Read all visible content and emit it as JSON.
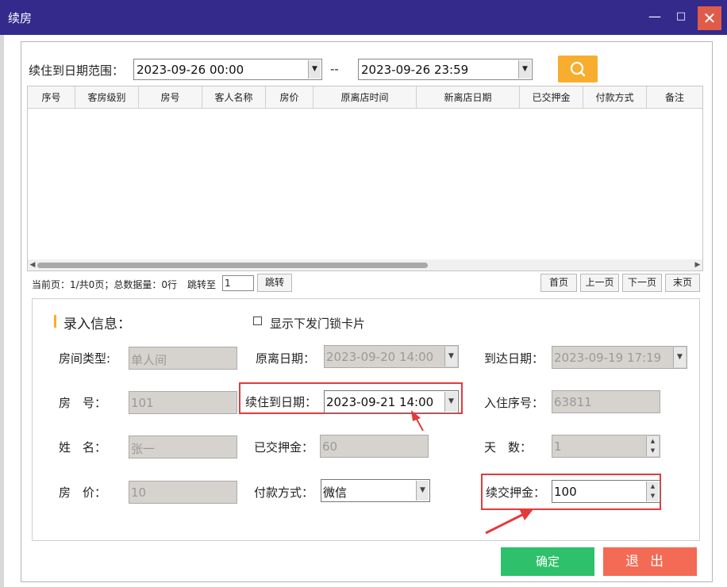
{
  "window": {
    "title": "续房",
    "minimize": "—",
    "maximize": "□",
    "close": "✕"
  },
  "search": {
    "label": "续住到日期范围：",
    "from": "2023-09-26 00:00",
    "separator": "--",
    "to": "2023-09-26 23:59"
  },
  "grid": {
    "columns": [
      "序号",
      "客房级别",
      "房号",
      "客人名称",
      "房价",
      "原离店时间",
      "新离店日期",
      "已交押金",
      "付款方式",
      "备注"
    ]
  },
  "pager": {
    "info": "当前页：1/共0页；总数据量：0行",
    "jump_label": "跳转至",
    "jump_value": "1",
    "jump_button": "跳转",
    "first": "首页",
    "prev": "上一页",
    "next": "下一页",
    "last": "末页"
  },
  "form": {
    "section_title": "录入信息：",
    "show_card_label": "显示下发门锁卡片",
    "room_type_label": "房间类型:",
    "room_type_value": "单人间",
    "orig_leave_label": "原离日期：",
    "orig_leave_value": "2023-09-20 14:00",
    "arrive_label": "到达日期：",
    "arrive_value": "2023-09-19 17:19",
    "room_no_label": "房　号：",
    "room_no_value": "101",
    "extend_date_label": "续住到日期：",
    "extend_date_value": "2023-09-21 14:00",
    "checkin_no_label": "入住序号：",
    "checkin_no_value": "63811",
    "name_label": "姓　名：",
    "name_value": "张一",
    "paid_deposit_label": "已交押金：",
    "paid_deposit_value": "60",
    "days_label": "天　数：",
    "days_value": "1",
    "price_label": "房　价：",
    "price_value": "10",
    "pay_method_label": "付款方式：",
    "pay_method_value": "微信",
    "extend_deposit_label": "续交押金：",
    "extend_deposit_value": "100"
  },
  "buttons": {
    "ok": "确定",
    "exit": "退出"
  },
  "colors": {
    "title_bar": "#332a8c",
    "search": "#f7ae2f",
    "ok": "#2ec06a",
    "exit": "#f36a55",
    "highlight": "#e53a3a"
  }
}
